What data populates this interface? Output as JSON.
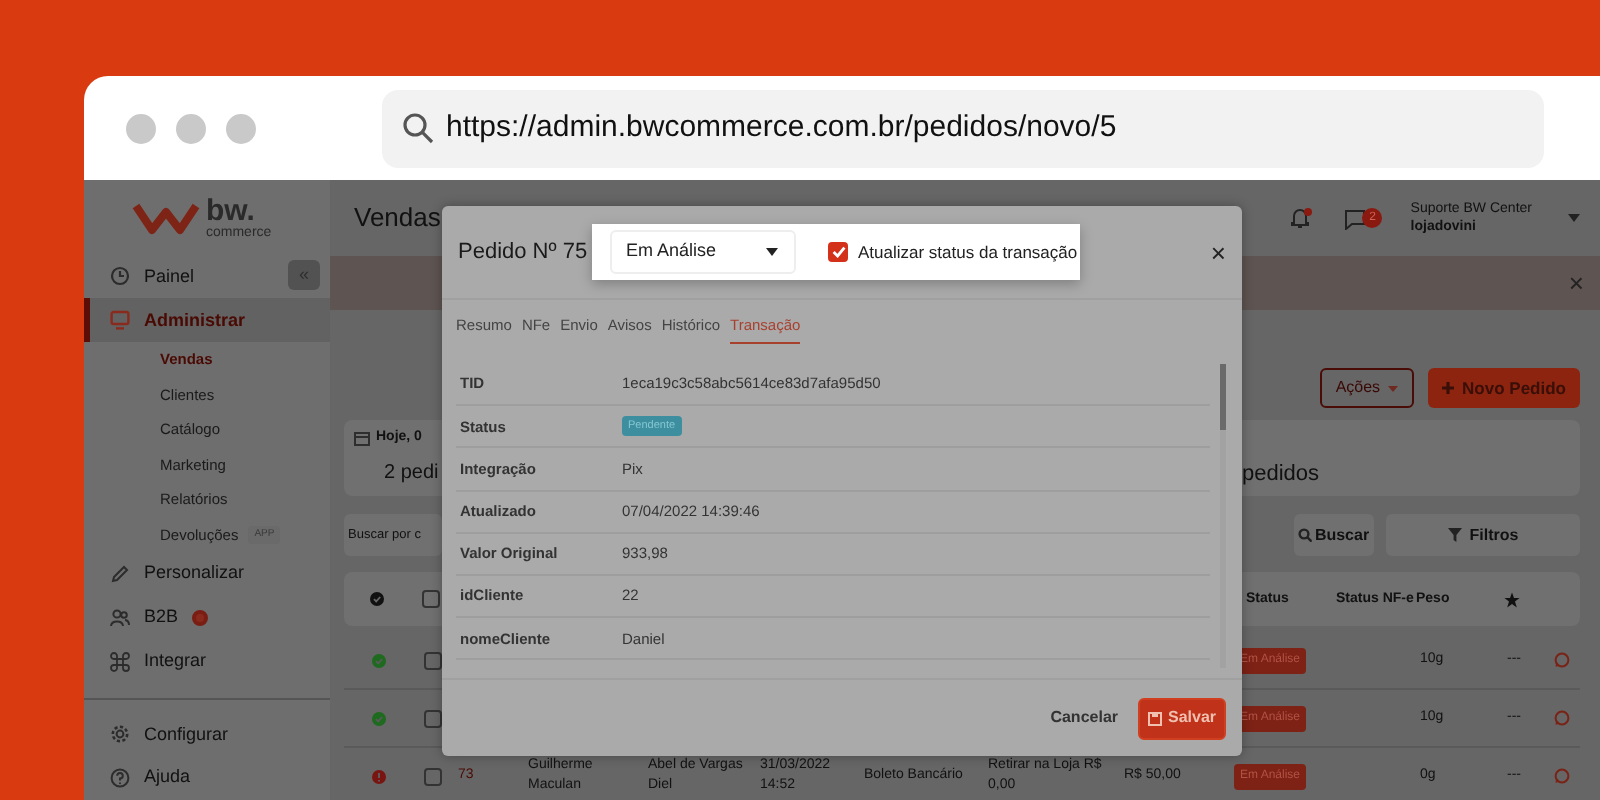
{
  "browser": {
    "url": "https://admin.bwcommerce.com.br/pedidos/novo/5"
  },
  "sidebar": {
    "logo_name": "bw.",
    "logo_tagline": "commerce",
    "collapse": "«",
    "items": [
      {
        "label": "Painel",
        "selected": false
      },
      {
        "label": "Administrar",
        "selected": true,
        "children": [
          {
            "label": "Vendas",
            "selected": true
          },
          {
            "label": "Clientes",
            "selected": false
          },
          {
            "label": "Catálogo",
            "selected": false
          },
          {
            "label": "Marketing",
            "selected": false
          },
          {
            "label": "Relatórios",
            "selected": false
          },
          {
            "label": "Devoluções",
            "selected": false,
            "badge": "APP"
          }
        ]
      },
      {
        "label": "Personalizar",
        "selected": false
      },
      {
        "label": "B2B",
        "selected": false,
        "alert": true
      },
      {
        "label": "Integrar",
        "selected": false
      }
    ],
    "footer_items": [
      {
        "label": "Configurar",
        "selected": false
      },
      {
        "label": "Ajuda",
        "selected": false
      }
    ]
  },
  "header": {
    "title": "Vendas",
    "notifications_unread": true,
    "messages_count": "2",
    "user": "Suporte BW Center",
    "store": "lojadovini"
  },
  "alert": {
    "close": "×"
  },
  "actions": {
    "menu": "Ações",
    "new_order": "Novo Pedido"
  },
  "summary": {
    "date": "Hoje, 0",
    "orders": "2 pedi",
    "orders_tail": "pedidos"
  },
  "search": {
    "placeholder": "Buscar por c",
    "button": "Buscar",
    "filters": "Filtros"
  },
  "table": {
    "select_all_checked": false,
    "columns": {
      "status": "Status",
      "nfe_status": "Status NF-e",
      "weight": "Peso"
    },
    "rows": [
      {
        "error": false,
        "checked": false,
        "status": "Em Análise",
        "weight": "10g",
        "rating": "---"
      },
      {
        "error": false,
        "checked": false,
        "status": "Em Análise",
        "weight": "10g",
        "rating": "---"
      },
      {
        "error": true,
        "checked": false,
        "number": "73",
        "customer": "Guilherme Maculan",
        "recipient": "Abel de Vargas Diel",
        "date": "31/03/2022 14:52",
        "payment": "Boleto Bancário",
        "shipping": "Retirar na Loja R$ 0,00",
        "total": "R$ 50,00",
        "status": "Em Análise",
        "weight": "0g",
        "rating": "---"
      }
    ]
  },
  "modal": {
    "title": "Pedido Nº 75",
    "close": "×",
    "status_select": "Em Análise",
    "update_transaction": {
      "label": "Atualizar status da transação",
      "checked": true
    },
    "tabs": [
      {
        "label": "Resumo",
        "selected": false
      },
      {
        "label": "NFe",
        "selected": false
      },
      {
        "label": "Envio",
        "selected": false
      },
      {
        "label": "Avisos",
        "selected": false
      },
      {
        "label": "Histórico",
        "selected": false
      },
      {
        "label": "Transação",
        "selected": true
      }
    ],
    "rows": [
      {
        "label": "TID",
        "value": "1eca19c3c58abc5614ce83d7afa95d50",
        "kind": "text"
      },
      {
        "label": "Status",
        "value": "Pendente",
        "kind": "badge"
      },
      {
        "label": "Integração",
        "value": "Pix",
        "kind": "text"
      },
      {
        "label": "Atualizado",
        "value": "07/04/2022 14:39:46",
        "kind": "text"
      },
      {
        "label": "Valor Original",
        "value": "933,98",
        "kind": "text"
      },
      {
        "label": "idCliente",
        "value": "22",
        "kind": "text"
      },
      {
        "label": "nomeCliente",
        "value": "Daniel",
        "kind": "text"
      }
    ],
    "cancel": "Cancelar",
    "save": "Salvar"
  }
}
